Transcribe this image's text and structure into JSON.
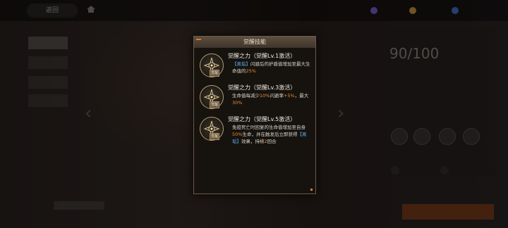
{
  "top_bar": {
    "back_label": "返回",
    "home_icon": "home-icon",
    "resources": [
      {
        "icon": "diamond-icon",
        "color": "#7b5fd6"
      },
      {
        "icon": "coin-icon",
        "color": "#c89a3a"
      },
      {
        "icon": "token-icon",
        "color": "#4a6fd0"
      }
    ]
  },
  "left_panel": {
    "tabs": [
      "",
      "",
      ""
    ],
    "character_name": "",
    "badge_text": ""
  },
  "right_panel": {
    "level": "90/100",
    "stats": [
      "",
      "",
      "",
      ""
    ]
  },
  "modal": {
    "title": "觉醒技能",
    "skills": [
      {
        "icon": "awakening-emblem-icon",
        "tag": "觉醒",
        "title": "觉醒之力（觉醒Lv.1激活）",
        "desc": [
          {
            "text": "【离垢】",
            "style": "blue"
          },
          {
            "text": "闪避后的护盾值增加至最大生命值的",
            "style": "normal"
          },
          {
            "text": "25%",
            "style": "orange"
          }
        ]
      },
      {
        "icon": "awakening-emblem-icon",
        "tag": "觉醒",
        "title": "觉醒之力（觉醒Lv.3激活）",
        "desc": [
          {
            "text": "生命值每减少",
            "style": "normal"
          },
          {
            "text": "10%",
            "style": "orange"
          },
          {
            "text": "闪避率",
            "style": "normal"
          },
          {
            "text": "+5%",
            "style": "orange"
          },
          {
            "text": "，最大",
            "style": "normal"
          },
          {
            "text": "30%",
            "style": "orange"
          }
        ]
      },
      {
        "icon": "awakening-emblem-icon",
        "tag": "觉醒",
        "title": "觉醒之力（觉醒Lv.5激活）",
        "desc": [
          {
            "text": "免疫死亡时回复的生命值增加至自身",
            "style": "normal"
          },
          {
            "text": "50%",
            "style": "orange"
          },
          {
            "text": "生命，并在触发后立即获得",
            "style": "normal"
          },
          {
            "text": "【离垢】",
            "style": "blue"
          },
          {
            "text": "效果，持续",
            "style": "normal"
          },
          {
            "text": "2",
            "style": "orange"
          },
          {
            "text": "回合",
            "style": "normal"
          }
        ]
      }
    ]
  }
}
